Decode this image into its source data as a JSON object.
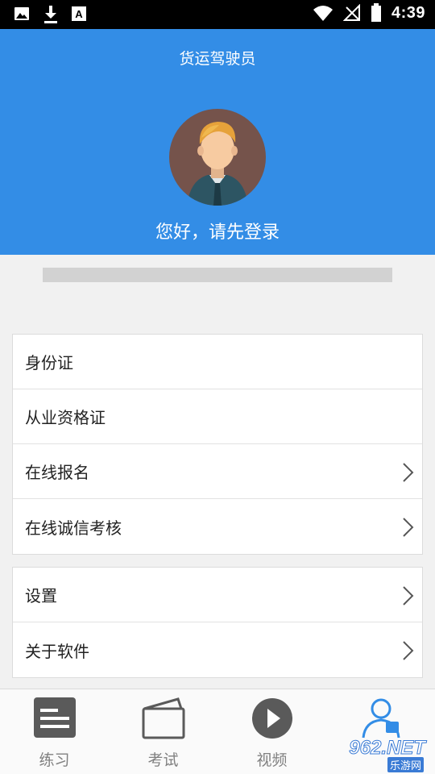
{
  "status_bar": {
    "time": "4:39",
    "icons": [
      "image-icon",
      "download-icon",
      "font-icon",
      "wifi-icon",
      "no-signal-icon",
      "battery-icon"
    ]
  },
  "header": {
    "app_title": "货运驾驶员",
    "greeting": "您好，请先登录",
    "background_color": "#338de6"
  },
  "menu_group_1": [
    {
      "label": "身份证",
      "chevron": false
    },
    {
      "label": "从业资格证",
      "chevron": false
    },
    {
      "label": "在线报名",
      "chevron": true
    },
    {
      "label": "在线诚信考核",
      "chevron": true
    }
  ],
  "menu_group_2": [
    {
      "label": "设置",
      "chevron": true
    },
    {
      "label": "关于软件",
      "chevron": true
    }
  ],
  "tab_bar": {
    "tabs": [
      {
        "label": "练习",
        "icon": "practice-list-icon"
      },
      {
        "label": "考试",
        "icon": "exam-card-icon"
      },
      {
        "label": "视频",
        "icon": "video-play-icon"
      },
      {
        "label": "",
        "icon": "user-profile-icon",
        "active": true
      }
    ]
  },
  "watermark": {
    "text": "962.NET",
    "subtext": "乐游网"
  }
}
